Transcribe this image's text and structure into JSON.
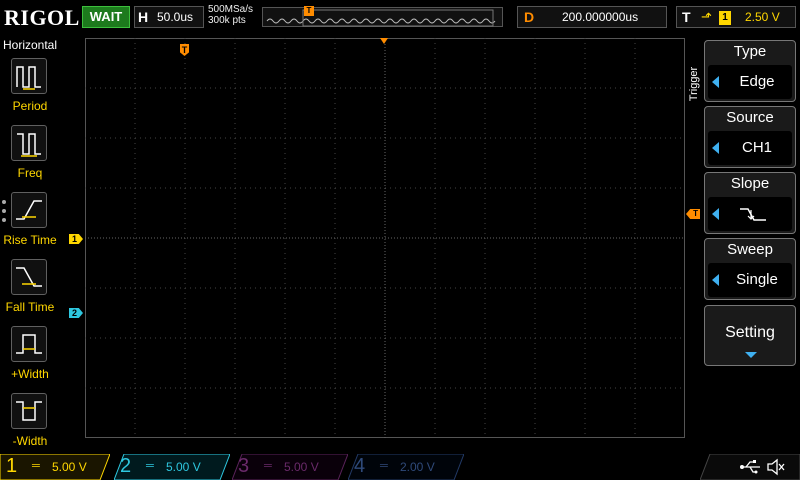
{
  "header": {
    "logo": "RIGOL",
    "status": "WAIT",
    "horizontal": {
      "key": "H",
      "value": "50.0us"
    },
    "sample_rate": "500MSa/s",
    "memory_depth": "300k pts",
    "delay": {
      "key": "D",
      "value": "200.000000us"
    },
    "trigger": {
      "key": "T",
      "edge_symbol": "⬏",
      "source": "1",
      "level": "2.50 V"
    }
  },
  "left_menu": {
    "title": "Horizontal",
    "items": [
      {
        "label": "Period"
      },
      {
        "label": "Freq"
      },
      {
        "label": "Rise Time"
      },
      {
        "label": "Fall Time"
      },
      {
        "label": "+Width"
      },
      {
        "label": "-Width"
      }
    ]
  },
  "right_menu": {
    "side_label": "Trigger",
    "type": {
      "title": "Type",
      "value": "Edge"
    },
    "source": {
      "title": "Source",
      "value": "CH1"
    },
    "slope": {
      "title": "Slope",
      "value": "falling"
    },
    "sweep": {
      "title": "Sweep",
      "value": "Single"
    },
    "setting": {
      "title": "Setting"
    }
  },
  "markers": {
    "trigger_pos": "T",
    "ch1": "1",
    "ch2": "2",
    "trig_level": "T"
  },
  "channels": [
    {
      "num": "1",
      "coupling": "═",
      "scale": "5.00 V",
      "color": "#ffd700"
    },
    {
      "num": "2",
      "coupling": "═",
      "scale": "5.00 V",
      "color": "#2ec8e0"
    },
    {
      "num": "3",
      "coupling": "═",
      "scale": "5.00 V",
      "color": "#d22fd2"
    },
    {
      "num": "4",
      "coupling": "═",
      "scale": "2.00 V",
      "color": "#3f6fd8"
    }
  ],
  "colors": {
    "ch1": "#ffd700",
    "ch2": "#2ec8e0",
    "ch3": "#d22fd2",
    "ch4": "#3f6fd8",
    "trigger": "#ff8c00",
    "accent": "#3fb0f0"
  },
  "icons": {
    "usb": "usb-icon",
    "mute": "speaker-mute-icon"
  }
}
